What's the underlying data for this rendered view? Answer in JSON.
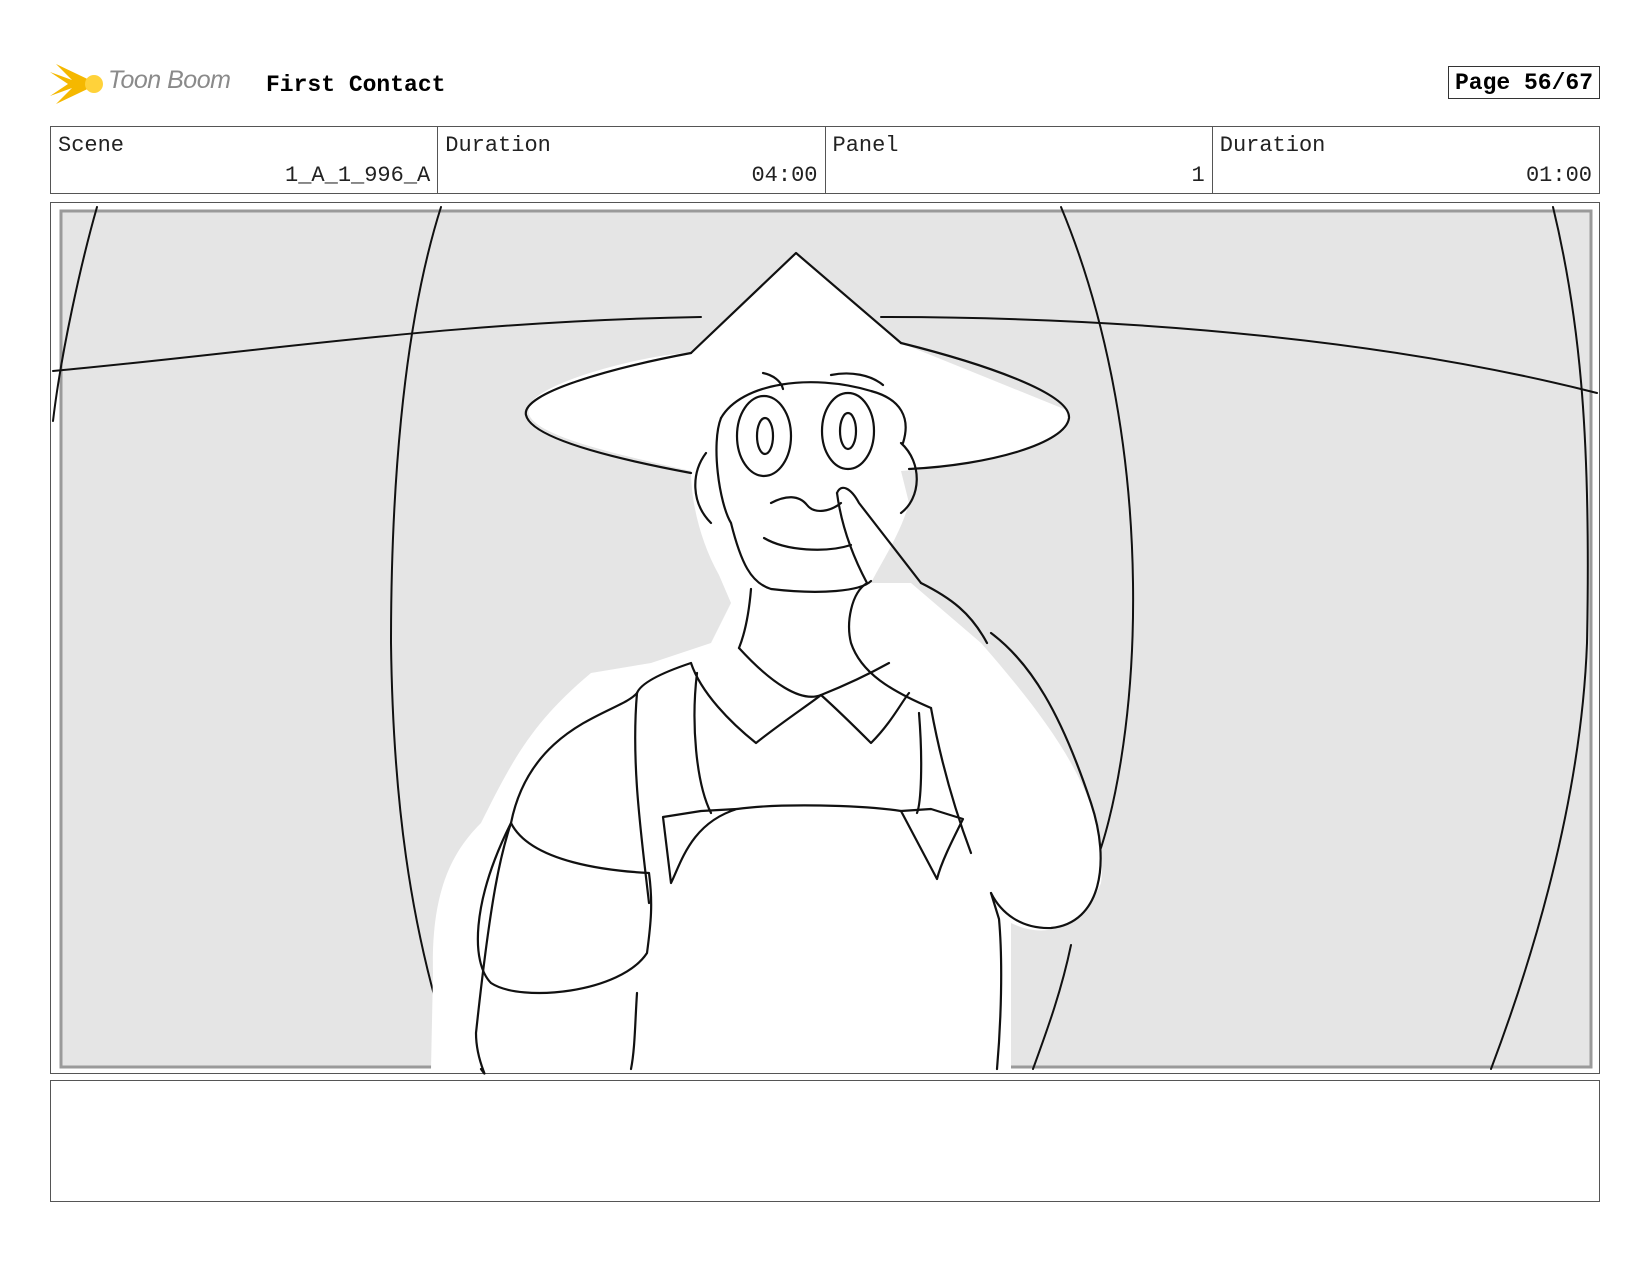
{
  "header": {
    "logo_text": "Toon Boom",
    "project_title": "First Contact",
    "page_label": "Page 56/67"
  },
  "info": {
    "scene_label": "Scene",
    "scene_value": "1_A_1_996_A",
    "scene_duration_label": "Duration",
    "scene_duration_value": "04:00",
    "panel_label": "Panel",
    "panel_value": "1",
    "panel_duration_label": "Duration",
    "panel_duration_value": "01:00"
  },
  "notes": {
    "text": ""
  },
  "colors": {
    "panel_background": "#e5e5e5",
    "line": "#111111",
    "logo_accent": "#f5b800"
  }
}
